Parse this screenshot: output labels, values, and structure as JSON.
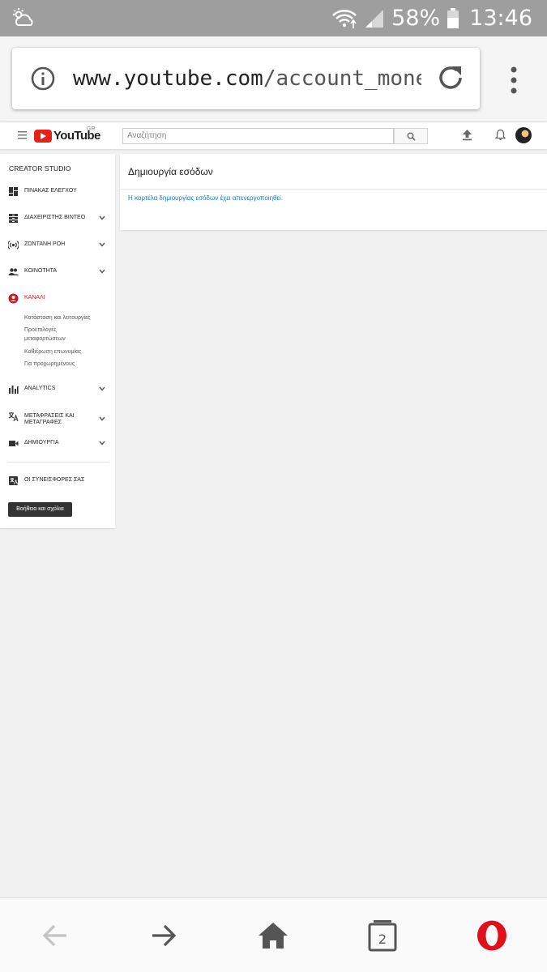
{
  "status_bar": {
    "battery_percent": "58%",
    "time": "13:46",
    "weather_icon": "weather-icon",
    "wifi_icon": "wifi-icon",
    "signal_icon": "signal-icon",
    "battery_icon": "battery-icon"
  },
  "browser": {
    "url_host": "www.youtube.com",
    "url_path": "/account_monetiza",
    "info_icon": "info-icon",
    "reload_icon": "reload-icon",
    "menu_icon": "more-vert-icon"
  },
  "youtube_header": {
    "logo_text": "YouTube",
    "region": "GR",
    "search_placeholder": "Αναζήτηση",
    "brand_color": "#e62117"
  },
  "sidebar": {
    "title": "CREATOR STUDIO",
    "items": [
      {
        "label": "ΠΙΝΑΚΑΣ ΕΛΕΓΧΟΥ",
        "icon": "dashboard-icon",
        "has_chevron": false
      },
      {
        "label": "ΔΙΑΧΕΙΡΙΣΤΗΣ ΒΙΝΤΕΟ",
        "icon": "video-manager-icon",
        "has_chevron": true
      },
      {
        "label": "ΖΩΝΤΑΝΗ ΡΟΗ",
        "icon": "live-stream-icon",
        "has_chevron": true
      },
      {
        "label": "ΚΟΙΝΟΤΗΤΑ",
        "icon": "community-icon",
        "has_chevron": true
      },
      {
        "label": "ΚΑΝΑΛΙ",
        "icon": "channel-icon",
        "has_chevron": false,
        "active": true
      },
      {
        "label": "ANALYTICS",
        "icon": "analytics-icon",
        "has_chevron": true
      },
      {
        "label_line1": "ΜΕΤΑΦΡΑΣΕΙΣ ΚΑΙ",
        "label_line2": "ΜΕΤΑΓΡΑΦΕΣ",
        "icon": "translate-icon",
        "has_chevron": true
      },
      {
        "label": "ΔΗΜΙΟΥΡΓΙΑ",
        "icon": "create-icon",
        "has_chevron": true
      },
      {
        "label": "ΟΙ ΣΥΝΕΙΣΦΟΡΕΣ ΣΑΣ",
        "icon": "contributions-icon",
        "has_chevron": false
      }
    ],
    "channel_subitems": [
      "Κατάσταση και λειτουργίες",
      "Προεπιλογές",
      "μεταφορτώσεων",
      "Καθιέρωση επωνυμίας",
      "Για προχωρημένους"
    ],
    "help_button": "Βοήθεια και σχόλια",
    "active_color": "#cc181e"
  },
  "main": {
    "title": "Δημιουργία εσόδων",
    "message": "Η καρτέλα δημιουργίας εσόδων έχει απενεργοποιηθεί.",
    "message_color": "#167ac6"
  },
  "bottom_nav": {
    "back_icon": "back-arrow-icon",
    "forward_icon": "forward-arrow-icon",
    "home_icon": "home-icon",
    "tabs_icon": "tabs-icon",
    "tabs_count": "2",
    "opera_icon": "opera-icon",
    "opera_color": "#e0101b"
  }
}
